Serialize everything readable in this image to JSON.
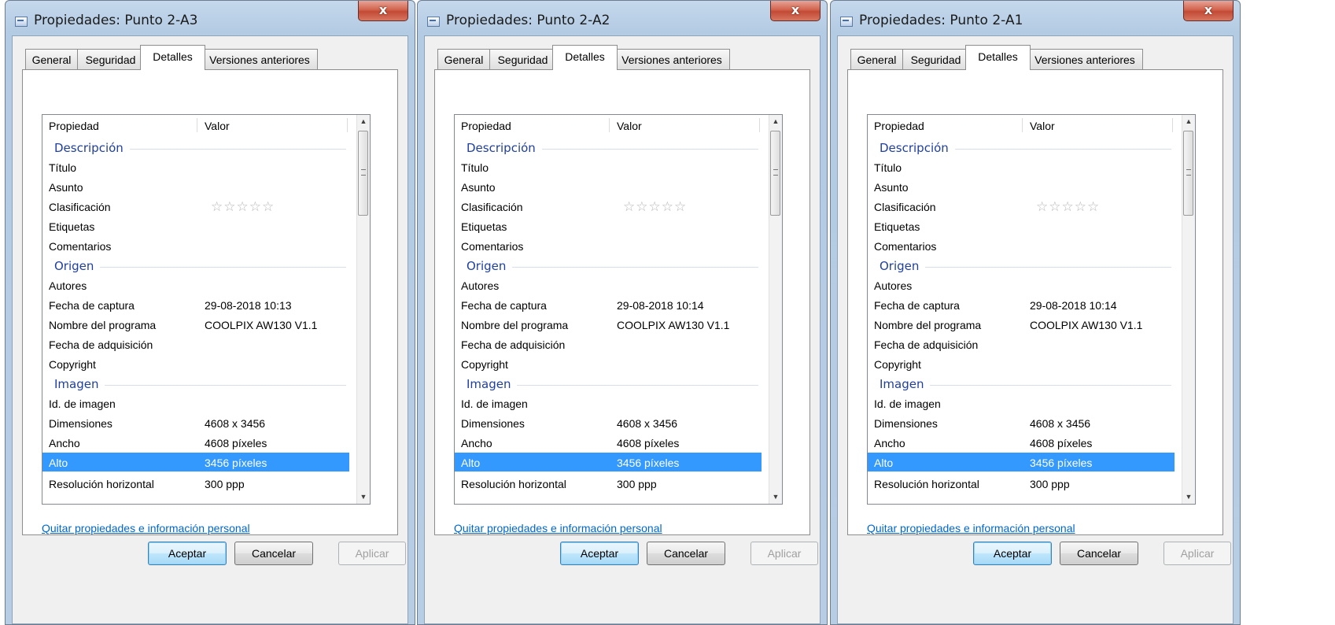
{
  "windows": [
    {
      "title": "Propiedades: Punto 2-A3",
      "close_label": "x",
      "tabs": [
        "General",
        "Seguridad",
        "Detalles",
        "Versiones anteriores"
      ],
      "active_tab": "Detalles",
      "columns": {
        "property": "Propiedad",
        "value": "Valor"
      },
      "rows": [
        {
          "type": "group",
          "name": "Descripción"
        },
        {
          "name": "Título",
          "value": ""
        },
        {
          "name": "Asunto",
          "value": ""
        },
        {
          "name": "Clasificación",
          "value": "",
          "stars": "☆☆☆☆☆",
          "rating": 0
        },
        {
          "name": "Etiquetas",
          "value": ""
        },
        {
          "name": "Comentarios",
          "value": ""
        },
        {
          "type": "group",
          "name": "Origen"
        },
        {
          "name": "Autores",
          "value": ""
        },
        {
          "name": "Fecha de captura",
          "value": "29-08-2018 10:13"
        },
        {
          "name": "Nombre del programa",
          "value": "COOLPIX AW130  V1.1"
        },
        {
          "name": "Fecha de adquisición",
          "value": ""
        },
        {
          "name": "Copyright",
          "value": ""
        },
        {
          "type": "group",
          "name": "Imagen"
        },
        {
          "name": "Id. de imagen",
          "value": ""
        },
        {
          "name": "Dimensiones",
          "value": "4608 x 3456"
        },
        {
          "name": "Ancho",
          "value": "4608 píxeles"
        },
        {
          "name": "Alto",
          "value": "3456 píxeles",
          "selected": true
        },
        {
          "name": "Resolución horizontal",
          "value": "300 ppp"
        }
      ],
      "link": "Quitar propiedades e información personal",
      "buttons": {
        "ok": "Aceptar",
        "cancel": "Cancelar",
        "apply": "Aplicar"
      }
    },
    {
      "title": "Propiedades: Punto 2-A2",
      "close_label": "x",
      "tabs": [
        "General",
        "Seguridad",
        "Detalles",
        "Versiones anteriores"
      ],
      "active_tab": "Detalles",
      "columns": {
        "property": "Propiedad",
        "value": "Valor"
      },
      "rows": [
        {
          "type": "group",
          "name": "Descripción"
        },
        {
          "name": "Título",
          "value": ""
        },
        {
          "name": "Asunto",
          "value": ""
        },
        {
          "name": "Clasificación",
          "value": "",
          "stars": "☆☆☆☆☆",
          "rating": 0
        },
        {
          "name": "Etiquetas",
          "value": ""
        },
        {
          "name": "Comentarios",
          "value": ""
        },
        {
          "type": "group",
          "name": "Origen"
        },
        {
          "name": "Autores",
          "value": ""
        },
        {
          "name": "Fecha de captura",
          "value": "29-08-2018 10:14"
        },
        {
          "name": "Nombre del programa",
          "value": "COOLPIX AW130  V1.1"
        },
        {
          "name": "Fecha de adquisición",
          "value": ""
        },
        {
          "name": "Copyright",
          "value": ""
        },
        {
          "type": "group",
          "name": "Imagen"
        },
        {
          "name": "Id. de imagen",
          "value": ""
        },
        {
          "name": "Dimensiones",
          "value": "4608 x 3456"
        },
        {
          "name": "Ancho",
          "value": "4608 píxeles"
        },
        {
          "name": "Alto",
          "value": "3456 píxeles",
          "selected": true
        },
        {
          "name": "Resolución horizontal",
          "value": "300 ppp"
        }
      ],
      "link": "Quitar propiedades e información personal",
      "buttons": {
        "ok": "Aceptar",
        "cancel": "Cancelar",
        "apply": "Aplicar"
      }
    },
    {
      "title": "Propiedades: Punto 2-A1",
      "close_label": "x",
      "tabs": [
        "General",
        "Seguridad",
        "Detalles",
        "Versiones anteriores"
      ],
      "active_tab": "Detalles",
      "columns": {
        "property": "Propiedad",
        "value": "Valor"
      },
      "rows": [
        {
          "type": "group",
          "name": "Descripción"
        },
        {
          "name": "Título",
          "value": ""
        },
        {
          "name": "Asunto",
          "value": ""
        },
        {
          "name": "Clasificación",
          "value": "",
          "stars": "☆☆☆☆☆",
          "rating": 0
        },
        {
          "name": "Etiquetas",
          "value": ""
        },
        {
          "name": "Comentarios",
          "value": ""
        },
        {
          "type": "group",
          "name": "Origen"
        },
        {
          "name": "Autores",
          "value": ""
        },
        {
          "name": "Fecha de captura",
          "value": "29-08-2018 10:14"
        },
        {
          "name": "Nombre del programa",
          "value": "COOLPIX AW130  V1.1"
        },
        {
          "name": "Fecha de adquisición",
          "value": ""
        },
        {
          "name": "Copyright",
          "value": ""
        },
        {
          "type": "group",
          "name": "Imagen"
        },
        {
          "name": "Id. de imagen",
          "value": ""
        },
        {
          "name": "Dimensiones",
          "value": "4608 x 3456"
        },
        {
          "name": "Ancho",
          "value": "4608 píxeles"
        },
        {
          "name": "Alto",
          "value": "3456 píxeles",
          "selected": true
        },
        {
          "name": "Resolución horizontal",
          "value": "300 ppp"
        }
      ],
      "link": "Quitar propiedades e información personal",
      "buttons": {
        "ok": "Aceptar",
        "cancel": "Cancelar",
        "apply": "Aplicar"
      }
    }
  ]
}
